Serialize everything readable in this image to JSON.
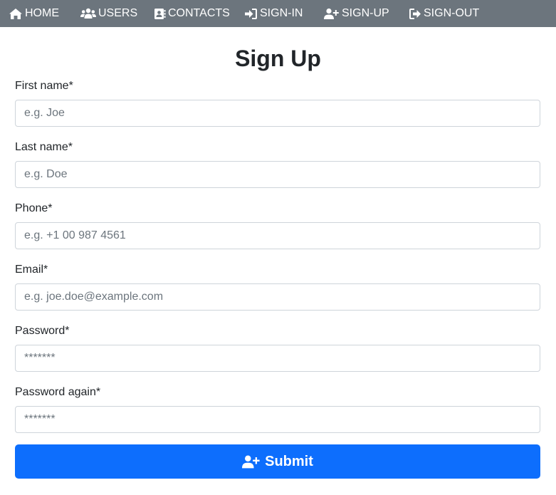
{
  "nav": {
    "items": [
      {
        "label": "HOME",
        "icon": "home-icon"
      },
      {
        "label": "USERS",
        "icon": "users-icon"
      },
      {
        "label": "CONTACTS",
        "icon": "address-book-icon"
      },
      {
        "label": "SIGN-IN",
        "icon": "sign-in-icon"
      },
      {
        "label": "SIGN-UP",
        "icon": "user-plus-icon"
      },
      {
        "label": "SIGN-OUT",
        "icon": "sign-out-icon"
      }
    ]
  },
  "form": {
    "title": "Sign Up",
    "fields": [
      {
        "label": "First name*",
        "placeholder": "e.g. Joe"
      },
      {
        "label": "Last name*",
        "placeholder": "e.g. Doe"
      },
      {
        "label": "Phone*",
        "placeholder": "e.g. +1 00 987 4561"
      },
      {
        "label": "Email*",
        "placeholder": "e.g. joe.doe@example.com"
      },
      {
        "label": "Password*",
        "placeholder": "*******"
      },
      {
        "label": "Password again*",
        "placeholder": "*******"
      }
    ],
    "submit": {
      "label": "Submit",
      "icon": "user-plus-icon"
    }
  },
  "colors": {
    "navbar": "#6c757d",
    "primary": "#0d6efd",
    "text": "#212529",
    "placeholder": "#6c757d",
    "border": "#ced4da"
  }
}
